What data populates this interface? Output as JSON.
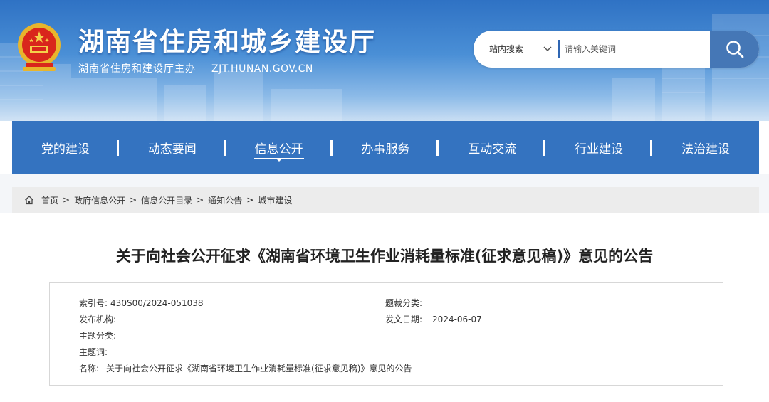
{
  "header": {
    "site_title": "湖南省住房和城乡建设厅",
    "sponsor": "湖南省住房和建设厅主办",
    "url": "ZJT.HUNAN.GOV.CN"
  },
  "search": {
    "scope_label": "站内搜索",
    "placeholder": "请输入关键词"
  },
  "nav": {
    "items": [
      {
        "label": "党的建设"
      },
      {
        "label": "动态要闻"
      },
      {
        "label": "信息公开"
      },
      {
        "label": "办事服务"
      },
      {
        "label": "互动交流"
      },
      {
        "label": "行业建设"
      },
      {
        "label": "法治建设"
      }
    ],
    "active": "信息公开"
  },
  "breadcrumb": {
    "items": [
      "首页",
      "政府信息公开",
      "信息公开目录",
      "通知公告",
      "城市建设"
    ],
    "separator": ">"
  },
  "article": {
    "title": "关于向社会公开征求《湖南省环境卫生作业消耗量标准(征求意见稿)》意见的公告"
  },
  "meta": {
    "index_label": "索引号:",
    "index_value": "430S00/2024-051038",
    "category_label": "题裁分类:",
    "category_value": "",
    "publisher_label": "发布机构:",
    "publisher_value": "",
    "date_label": "发文日期:",
    "date_value": "2024-06-07",
    "topic_label": "主题分类:",
    "topic_value": "",
    "keywords_label": "主题词:",
    "keywords_value": "",
    "name_label": "名称:",
    "name_value": "关于向社会公开征求《湖南省环境卫生作业消耗量标准(征求意见稿)》意见的公告"
  },
  "colors": {
    "nav_bg": "#3473c0",
    "search_button": "#4577b6",
    "header_top": "#2f72c4"
  }
}
